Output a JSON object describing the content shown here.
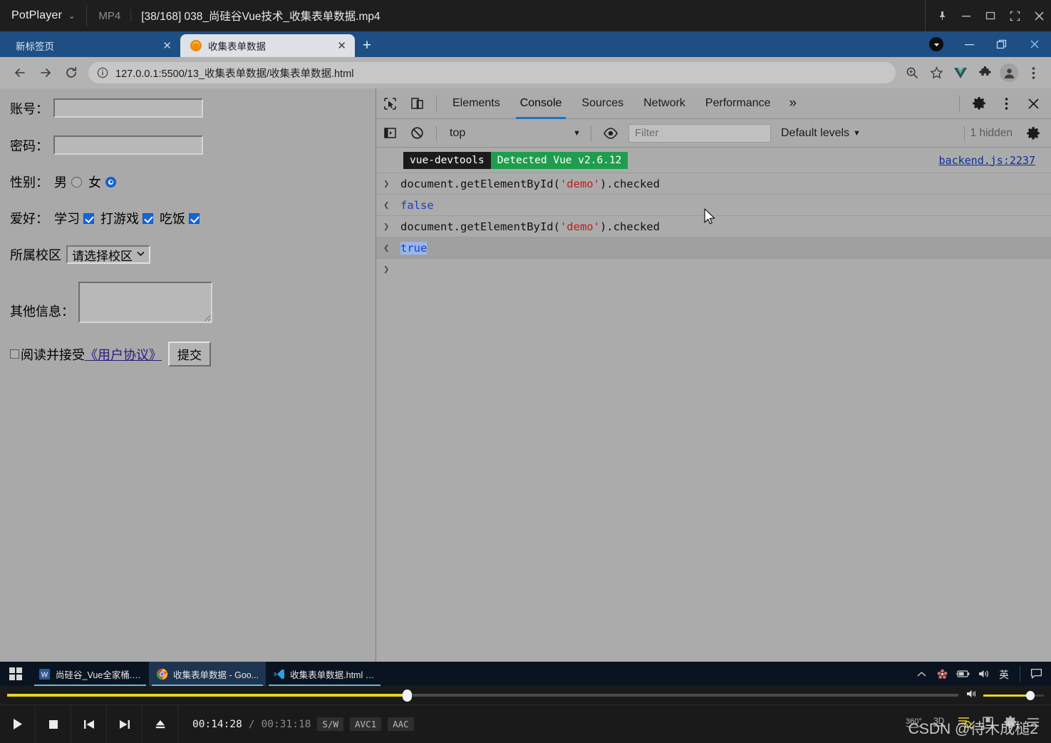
{
  "potplayer": {
    "app_name": "PotPlayer",
    "dropdown_caret": "⌄",
    "format": "MP4",
    "video_title": "[38/168] 038_尚硅谷Vue技术_收集表单数据.mp4",
    "window_buttons": [
      "pin",
      "minimize",
      "maximize",
      "fullscreen",
      "close"
    ],
    "controls": {
      "play_label": "play",
      "stop_label": "stop",
      "prev_label": "previous",
      "next_label": "next",
      "eject_label": "eject",
      "current_time": "00:14:28",
      "separator": "/",
      "total_time": "00:31:18",
      "chips": [
        "S/W",
        "AVC1",
        "AAC"
      ],
      "right_icons": [
        "360°",
        "3D",
        "playlist-search",
        "bookmark",
        "settings",
        "menu"
      ],
      "progress_percent": 42,
      "volume_percent": 72
    },
    "watermark": "CSDN @待木成槌2"
  },
  "chrome": {
    "tabs": [
      {
        "title": "新标签页",
        "active": false,
        "close": "✕"
      },
      {
        "title": "收集表单数据",
        "active": true,
        "close": "✕"
      }
    ],
    "new_tab_label": "+",
    "window_buttons": [
      "profile",
      "minimize",
      "restore",
      "close"
    ],
    "nav": {
      "back": "←",
      "forward": "→",
      "reload": "⟳"
    },
    "url": "127.0.0.1:5500/13_收集表单数据/收集表单数据.html",
    "omnibox_icons": [
      "zoom-icon",
      "bookmark-star-icon",
      "vue-devtools-icon",
      "extensions-icon",
      "profile-icon",
      "chrome-menu-icon"
    ]
  },
  "page": {
    "account_label": "账号：",
    "account_value": "",
    "password_label": "密码：",
    "password_value": "",
    "gender_label": "性别：",
    "gender_options": [
      {
        "label": "男",
        "checked": false
      },
      {
        "label": "女",
        "checked": true
      }
    ],
    "hobby_label": "爱好：",
    "hobby_options": [
      {
        "label": "学习",
        "checked": true
      },
      {
        "label": "打游戏",
        "checked": true
      },
      {
        "label": "吃饭",
        "checked": true
      }
    ],
    "campus_label": "所属校区",
    "campus_selected": "请选择校区",
    "campus_caret": "⌄",
    "other_label": "其他信息：",
    "other_value": "",
    "agree_checked": false,
    "agree_text": "阅读并接受",
    "agree_link": "《用户协议》",
    "submit_label": "提交"
  },
  "devtools": {
    "toolbar_icons": [
      "inspect-element-icon",
      "device-toolbar-icon"
    ],
    "tabs": [
      {
        "label": "Elements",
        "selected": false
      },
      {
        "label": "Console",
        "selected": true
      },
      {
        "label": "Sources",
        "selected": false
      },
      {
        "label": "Network",
        "selected": false
      },
      {
        "label": "Performance",
        "selected": false
      }
    ],
    "more_tabs": "»",
    "settings_icon": "gear-icon",
    "menu_icon": "kebab-menu-icon",
    "close_icon": "close-icon",
    "console_toolbar": {
      "sidebar_icon": "console-sidebar-icon",
      "clear_icon": "clear-console-icon",
      "context": "top",
      "context_caret": "▼",
      "eye_icon": "live-expression-icon",
      "filter_placeholder": "Filter",
      "filter_value": "",
      "levels": "Default levels",
      "levels_caret": "▼",
      "hidden_count": "1 hidden",
      "settings_icon": "console-settings-icon"
    },
    "logs": [
      {
        "type": "banner",
        "badge_dark": "vue-devtools",
        "badge_green": "Detected Vue v2.6.12",
        "source": "backend.js:2237"
      },
      {
        "type": "input",
        "arrow": "❯",
        "code_pre": "document.getElementById(",
        "code_str": "'demo'",
        "code_post": ").checked"
      },
      {
        "type": "output",
        "arrow": "❮",
        "value": "false",
        "highlighted": false
      },
      {
        "type": "input",
        "arrow": "❯",
        "code_pre": "document.getElementById(",
        "code_str": "'demo'",
        "code_post": ").checked"
      },
      {
        "type": "output",
        "arrow": "❮",
        "value": "true",
        "highlighted": true
      }
    ],
    "prompt": "❯"
  },
  "taskbar": {
    "start_label": "start",
    "items": [
      {
        "label": "尚硅谷_Vue全家桶.d...",
        "icon": "word-icon",
        "active": false
      },
      {
        "label": "收集表单数据 - Goo...",
        "icon": "chrome-icon",
        "active": true
      },
      {
        "label": "收集表单数据.html - ...",
        "icon": "vscode-icon",
        "active": false
      }
    ],
    "tray": [
      "show-hidden-icons-chevron",
      "app-icon",
      "battery-icon",
      "volume-icon",
      "ime-english-icon",
      "notifications-icon"
    ],
    "ime_label": "英"
  },
  "colors": {
    "chrome_blue": "#1d4e84",
    "page_gray": "#a9a9a9",
    "devtools_gray": "#ababab",
    "accent_blue": "#1565d8",
    "tab_underline": "#1a73c8",
    "vue_green": "#1f9d4e",
    "potplayer_yellow": "#e8d527",
    "string_red": "#c41a16",
    "bool_blue": "#1843c4",
    "link_blue": "#0e2ea0"
  }
}
